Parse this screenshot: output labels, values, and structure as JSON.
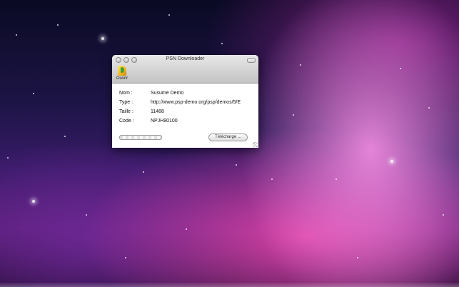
{
  "window": {
    "title": "PSN Downloader",
    "toolbar": {
      "open_label": "Ouvrir"
    },
    "fields": [
      {
        "label": "Nom :",
        "value": "Susume Demo"
      },
      {
        "label": "Type :",
        "value": "http://www.psp-demo.org/psp/demos/5/E"
      },
      {
        "label": "Taille :",
        "value": "11488"
      },
      {
        "label": "Code :",
        "value": "NPJH90100"
      }
    ],
    "download_button": "Télécharge ...",
    "progress": 0
  },
  "icons": {
    "close": "close-button-icon",
    "minimize": "minimize-button-icon",
    "zoom": "zoom-button-icon",
    "open": "folder-open-icon",
    "toolbar_toggle": "toolbar-toggle-icon"
  }
}
